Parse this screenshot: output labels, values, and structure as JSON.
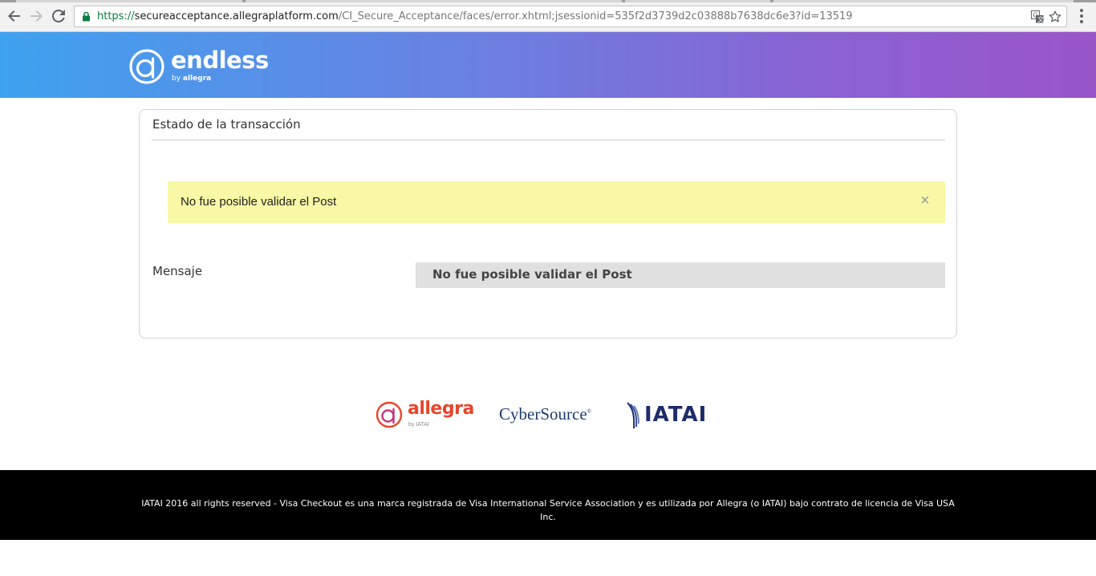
{
  "browser": {
    "url_scheme": "https://",
    "url_host": "secureacceptance.allegraplatform.com",
    "url_path": "/CI_Secure_Acceptance/faces/error.xhtml;jsessionid=535f2d3739d2c03888b7638dc6e3?id=13519",
    "back_icon": "arrow-left-icon",
    "forward_icon": "arrow-right-icon",
    "reload_icon": "reload-icon",
    "lock_icon": "lock-icon",
    "translate_icon": "translate-icon",
    "bookmark_icon": "star-icon",
    "menu_icon": "kebab-menu-icon"
  },
  "header": {
    "brand_name": "endless",
    "brand_by_prefix": "by ",
    "brand_by_name": "allegra"
  },
  "card": {
    "title": "Estado de la transacción",
    "alert": {
      "message": "No fue posible validar el Post",
      "close_symbol": "×",
      "background": "#f8f8a6"
    },
    "field": {
      "label": "Mensaje",
      "value": "No fue posible validar el Post"
    }
  },
  "partners": {
    "allegra_name": "allegra",
    "allegra_by": "by IATAI",
    "cybersource_name": "CyberSource",
    "cybersource_mark": "®",
    "iatai_name": "IATAI"
  },
  "footer": {
    "text": "IATAI 2016 all rights reserved - Visa Checkout es una marca registrada de Visa International Service Association y es utilizada por Allegra (o IATAI) bajo contrato de licencia de Visa USA Inc."
  },
  "colors": {
    "header_gradient_start": "#3fa2f0",
    "header_gradient_end": "#9a55c9",
    "allegra_brand": "#e8452c",
    "iatai_brand": "#1d2d6a",
    "footer_bg": "#000000"
  }
}
